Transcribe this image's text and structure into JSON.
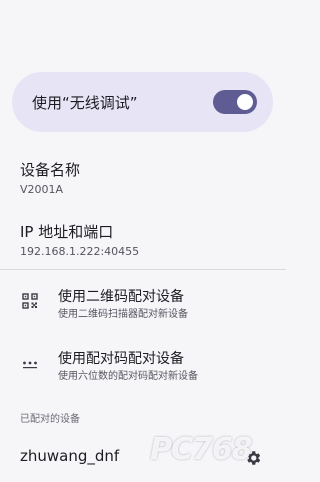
{
  "wireless_debug": {
    "label": "使用“无线调试”",
    "enabled": true
  },
  "device_name": {
    "title": "设备名称",
    "value": "V2001A"
  },
  "ip_port": {
    "title": "IP 地址和端口",
    "value": "192.168.1.222:40455"
  },
  "actions": [
    {
      "title": "使用二维码配对设备",
      "subtitle": "使用二维码扫描器配对新设备",
      "icon": "qr-code-icon"
    },
    {
      "title": "使用配对码配对设备",
      "subtitle": "使用六位数的配对码配对新设备",
      "icon": "dialpad-icon"
    }
  ],
  "paired_section": {
    "header": "已配对的设备"
  },
  "paired_devices": [
    {
      "name": "zhuwang_dnf",
      "icon": "gear-icon"
    }
  ],
  "watermark": "PC768",
  "colors": {
    "accent": "#5f5c94",
    "card": "#e7e4f6",
    "background": "#f6f6f9"
  }
}
